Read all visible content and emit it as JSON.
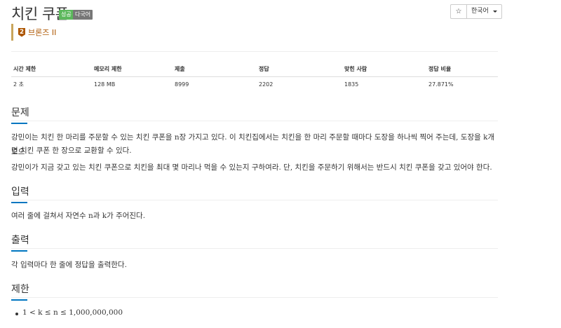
{
  "header": {
    "title": "치킨 쿠폰",
    "badges": [
      "성공",
      "다국어"
    ],
    "star_icon": "star-outline-icon",
    "language": "한국어"
  },
  "tier": {
    "label": "브론즈 II",
    "icon_text": "2"
  },
  "info_table": {
    "headers": [
      "시간 제한",
      "메모리 제한",
      "제출",
      "정답",
      "맞힌 사람",
      "정답 비율"
    ],
    "values": [
      "2 초",
      "128 MB",
      "8999",
      "2202",
      "1835",
      "27.871%"
    ]
  },
  "sections": {
    "problem": {
      "title": "문제",
      "p1_line1": "강민이는 치킨 한 마리를 주문할 수 있는 치킨 쿠폰을 n장 가지고 있다. 이 치킨집에서는 치킨을 한 마리 주문할 때마다 도장을 하나씩 찍어 주는데, 도장을 k개 모으",
      "p1_line2": "면 치킨 쿠폰 한 장으로 교환할 수 있다.",
      "p2": "강민이가 지금 갖고 있는 치킨 쿠폰으로 치킨을 최대 몇 마리나 먹을 수 있는지 구하여라. 단, 치킨을 주문하기 위해서는 반드시 치킨 쿠폰을 갖고 있어야 한다."
    },
    "input": {
      "title": "입력",
      "text": "여러 줄에 걸쳐서 자연수 n과 k가 주어진다."
    },
    "output": {
      "title": "출력",
      "text": "각 입력마다 한 줄에 정답을 출력한다."
    },
    "limit": {
      "title": "제한",
      "items": [
        "1 < k ≤ n ≤ 1,000,000,000"
      ]
    }
  },
  "colors": {
    "success": "#5cb85c",
    "tier": "#ad5600",
    "accent": "#0076c0"
  }
}
